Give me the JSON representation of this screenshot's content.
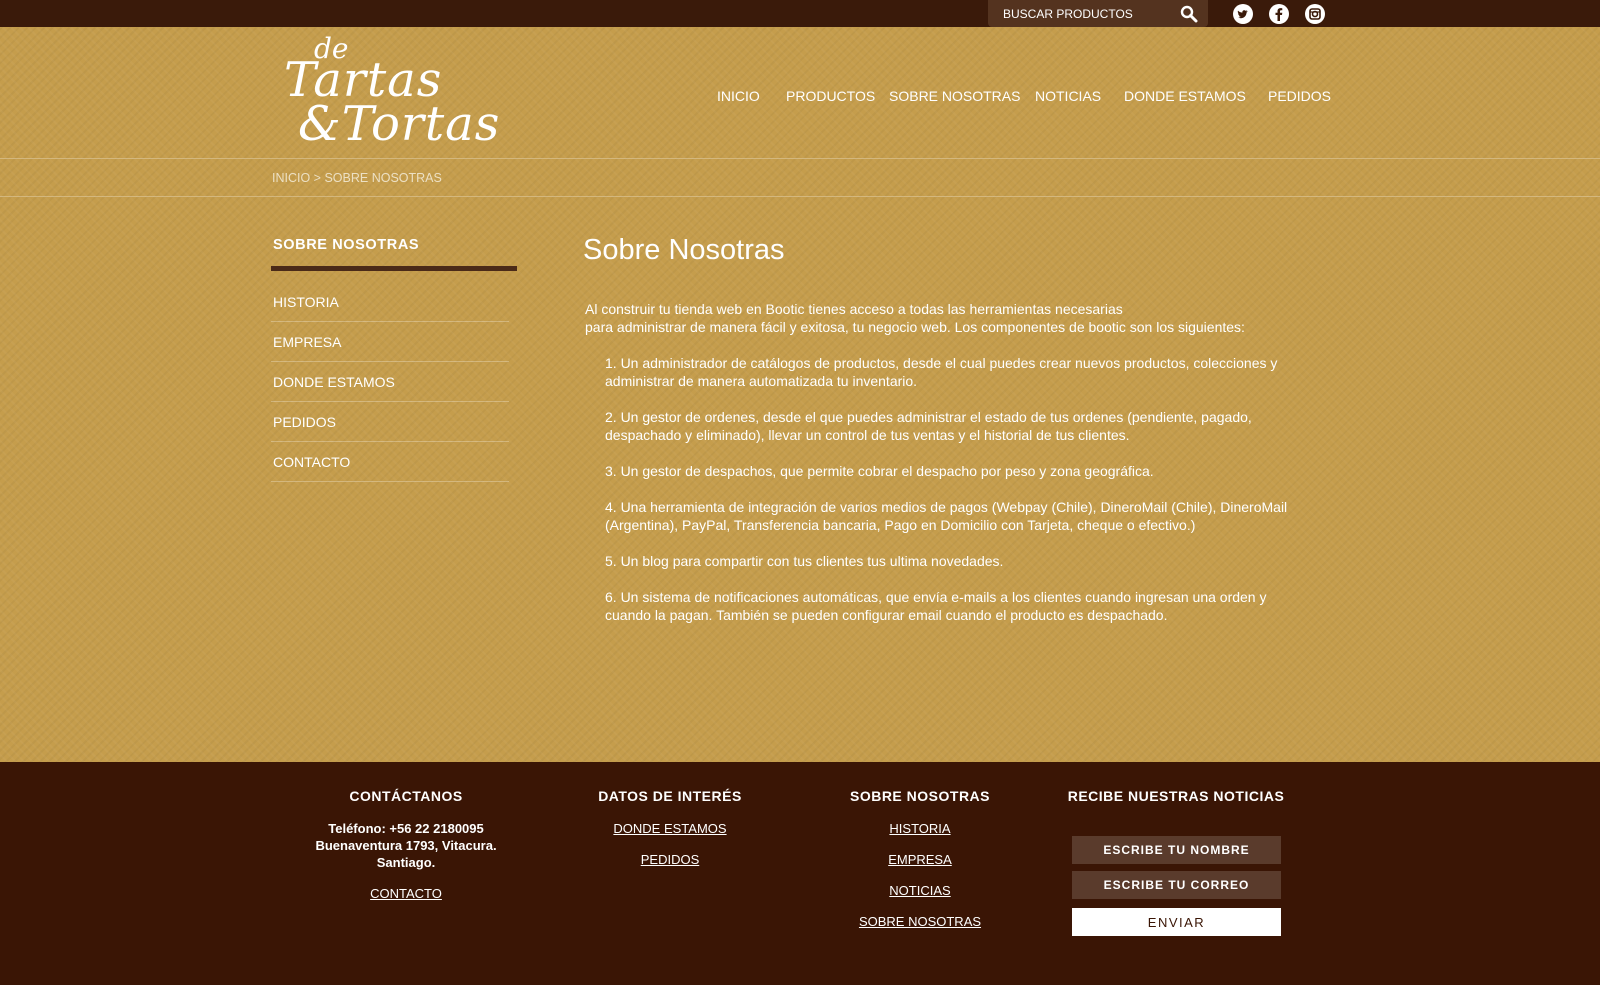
{
  "top_bar": {
    "search_placeholder": "BUSCAR PRODUCTOS",
    "social": [
      "twitter-icon",
      "facebook-icon",
      "instagram-icon"
    ]
  },
  "logo": {
    "line_small": "de",
    "line_1": "Tartas",
    "line_2": "&Tortas"
  },
  "nav": {
    "items": [
      "INICIO",
      "PRODUCTOS",
      "SOBRE NOSOTRAS",
      "NOTICIAS",
      "DONDE ESTAMOS",
      "PEDIDOS"
    ]
  },
  "breadcrumb": {
    "home": "INICIO",
    "separator": " > ",
    "current": "SOBRE NOSOTRAS"
  },
  "sidebar": {
    "title": "SOBRE NOSOTRAS",
    "items": [
      "HISTORIA",
      "EMPRESA",
      "DONDE ESTAMOS",
      "PEDIDOS",
      "CONTACTO"
    ]
  },
  "content": {
    "title": "Sobre Nosotras",
    "intro_1": "Al construir tu tienda web en Bootic tienes acceso a todas las herramientas necesarias",
    "intro_2": "para administrar de manera fácil y exitosa, tu negocio web. Los componentes de bootic son los siguientes:",
    "items": [
      "1. Un administrador de catálogos de productos, desde el cual puedes crear nuevos productos, colecciones y administrar de manera automatizada tu inventario.",
      "2. Un gestor de ordenes, desde el que puedes administrar el estado de tus ordenes (pendiente, pagado, despachado y eliminado), llevar un control de tus ventas y el historial de tus clientes.",
      "3. Un  gestor de despachos, que permite cobrar el despacho por peso y zona geográfica.",
      "4. Una herramienta de integración de varios medios de pagos (Webpay (Chile), DineroMail (Chile), DineroMail (Argentina), PayPal, Transferencia bancaria, Pago en Domicilio con Tarjeta, cheque o efectivo.)",
      "5. Un blog para compartir con tus clientes tus ultima novedades.",
      "6. Un sistema de notificaciones automáticas, que envía e-mails a los clientes cuando ingresan una orden y cuando la pagan. También se pueden configurar email cuando el producto es despachado."
    ]
  },
  "footer": {
    "contact": {
      "title": "CONTÁCTANOS",
      "phone": "Teléfono: +56 22 2180095",
      "address": "Buenaventura 1793, Vitacura.",
      "city": "Santiago.",
      "link": "CONTACTO"
    },
    "info": {
      "title": "DATOS DE INTERÉS",
      "links": [
        "DONDE ESTAMOS",
        "PEDIDOS"
      ]
    },
    "about": {
      "title": "SOBRE NOSOTRAS",
      "links": [
        "HISTORIA ",
        "EMPRESA",
        "NOTICIAS",
        "SOBRE NOSOTRAS"
      ]
    },
    "newsletter": {
      "title": "RECIBE NUESTRAS NOTICIAS",
      "name_placeholder": "ESCRIBE TU NOMBRE",
      "email_placeholder": "ESCRIBE TU CORREO",
      "submit": "ENVIAR"
    }
  },
  "colors": {
    "background": "#c59d4c",
    "top_bar": "#3a1a0a",
    "footer": "#3a1505",
    "input": "#5a3b2c"
  }
}
